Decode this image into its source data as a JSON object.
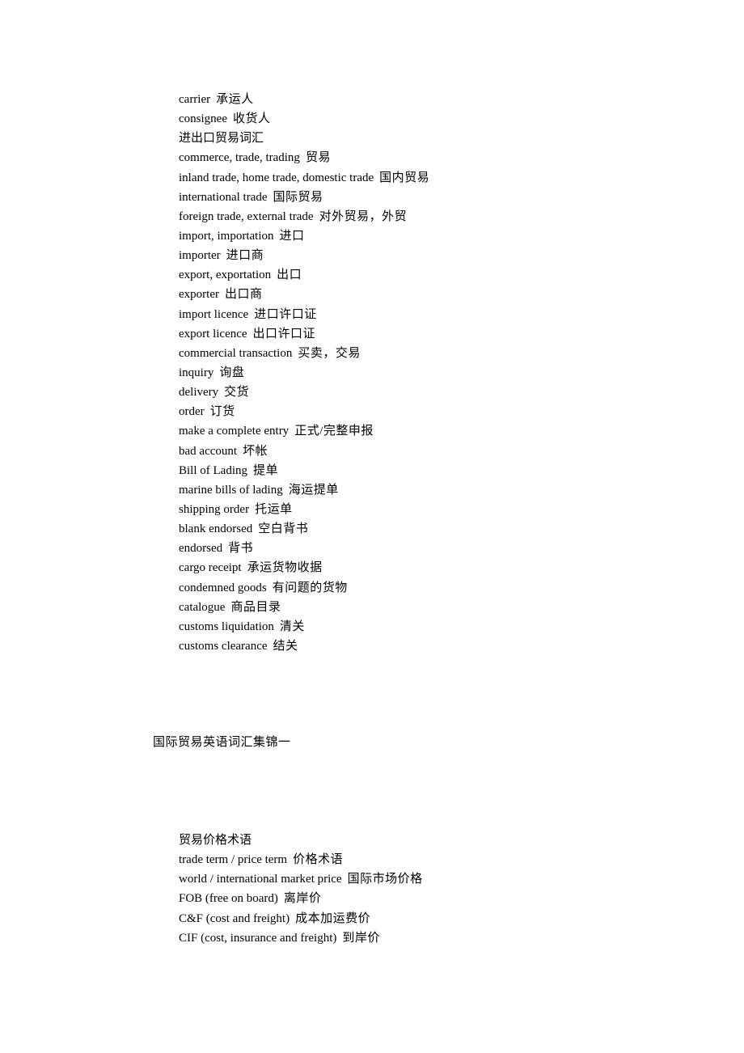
{
  "section_1": {
    "entries": [
      {
        "en": "carrier",
        "zh": "承运人"
      },
      {
        "en": "consignee",
        "zh": "收货人"
      },
      {
        "en": "",
        "zh": "进出口贸易词汇"
      },
      {
        "en": "commerce, trade, trading",
        "zh": "贸易"
      },
      {
        "en": "inland trade, home trade, domestic trade",
        "zh": "国内贸易"
      },
      {
        "en": "international trade",
        "zh": "国际贸易"
      },
      {
        "en": "foreign trade, external trade",
        "zh": "对外贸易，外贸"
      },
      {
        "en": "import, importation",
        "zh": "进口"
      },
      {
        "en": "importer",
        "zh": "进口商"
      },
      {
        "en": "export, exportation",
        "zh": "出口"
      },
      {
        "en": "exporter",
        "zh": "出口商"
      },
      {
        "en": "import licence",
        "zh": "进口许口证"
      },
      {
        "en": "export licence",
        "zh": "出口许口证"
      },
      {
        "en": "commercial transaction",
        "zh": "买卖，交易"
      },
      {
        "en": "inquiry",
        "zh": "询盘"
      },
      {
        "en": "delivery",
        "zh": "交货"
      },
      {
        "en": "order",
        "zh": "订货"
      },
      {
        "en": "make a complete entry",
        "zh": "正式/完整申报"
      },
      {
        "en": "bad account",
        "zh": "坏帐"
      },
      {
        "en": "Bill of Lading",
        "zh": "提单"
      },
      {
        "en": "marine bills of lading",
        "zh": "海运提单"
      },
      {
        "en": "shipping order",
        "zh": "托运单"
      },
      {
        "en": "blank endorsed",
        "zh": "空白背书"
      },
      {
        "en": "endorsed",
        "zh": "背书"
      },
      {
        "en": "cargo receipt",
        "zh": "承运货物收据"
      },
      {
        "en": "condemned goods",
        "zh": "有问题的货物"
      },
      {
        "en": "catalogue",
        "zh": "商品目录"
      },
      {
        "en": "customs liquidation",
        "zh": "清关"
      },
      {
        "en": "customs clearance",
        "zh": "结关"
      }
    ]
  },
  "heading": "国际贸易英语词汇集锦一",
  "section_2": {
    "entries": [
      {
        "en": "",
        "zh": "贸易价格术语"
      },
      {
        "en": "trade term / price term",
        "zh": "价格术语"
      },
      {
        "en": "world / international market price",
        "zh": "国际市场价格"
      },
      {
        "en": "FOB (free on board)",
        "zh": "离岸价"
      },
      {
        "en": "C&F (cost and freight)",
        "zh": "成本加运费价"
      },
      {
        "en": "CIF (cost, insurance and freight)",
        "zh": "到岸价"
      }
    ]
  }
}
